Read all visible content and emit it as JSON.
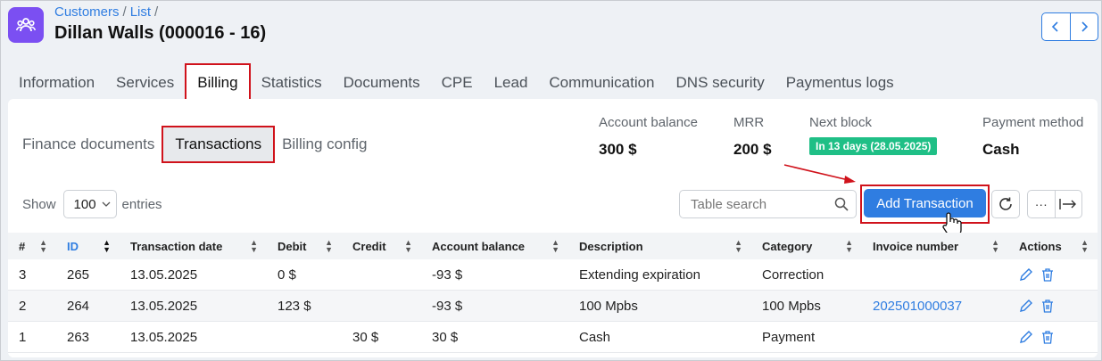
{
  "breadcrumb": {
    "customers": "Customers",
    "list": "List"
  },
  "page_title": "Dillan Walls (000016 - 16)",
  "tabs": [
    "Information",
    "Services",
    "Billing",
    "Statistics",
    "Documents",
    "CPE",
    "Lead",
    "Communication",
    "DNS security",
    "Paymentus logs"
  ],
  "active_tab": "Billing",
  "subtabs": [
    "Finance documents",
    "Transactions",
    "Billing config"
  ],
  "active_subtab": "Transactions",
  "stats": {
    "account_balance": {
      "label": "Account balance",
      "value": "300 $"
    },
    "mrr": {
      "label": "MRR",
      "value": "200 $"
    },
    "next_block": {
      "label": "Next block",
      "value": "In 13 days (28.05.2025)"
    },
    "payment_method": {
      "label": "Payment method",
      "value": "Cash"
    }
  },
  "controls": {
    "show_label": "Show",
    "entries_value": "100",
    "entries_label": "entries",
    "search_placeholder": "Table search",
    "add_button": "Add Transaction",
    "more": "···"
  },
  "table": {
    "headers": [
      "#",
      "ID",
      "Transaction date",
      "Debit",
      "Credit",
      "Account balance",
      "Description",
      "Category",
      "Invoice number",
      "Actions"
    ],
    "rows": [
      [
        "3",
        "265",
        "13.05.2025",
        "0 $",
        "",
        "-93 $",
        "Extending expiration",
        "Correction",
        ""
      ],
      [
        "2",
        "264",
        "13.05.2025",
        "123 $",
        "",
        "-93 $",
        "100 Mpbs",
        "100 Mpbs",
        "202501000037"
      ],
      [
        "1",
        "263",
        "13.05.2025",
        "",
        "30 $",
        "30 $",
        "Cash",
        "Payment",
        ""
      ]
    ]
  },
  "colors": {
    "accent": "#2f7de1",
    "brand": "#7b4ff2",
    "highlight": "#d0121b",
    "badge": "#1fbf86"
  }
}
